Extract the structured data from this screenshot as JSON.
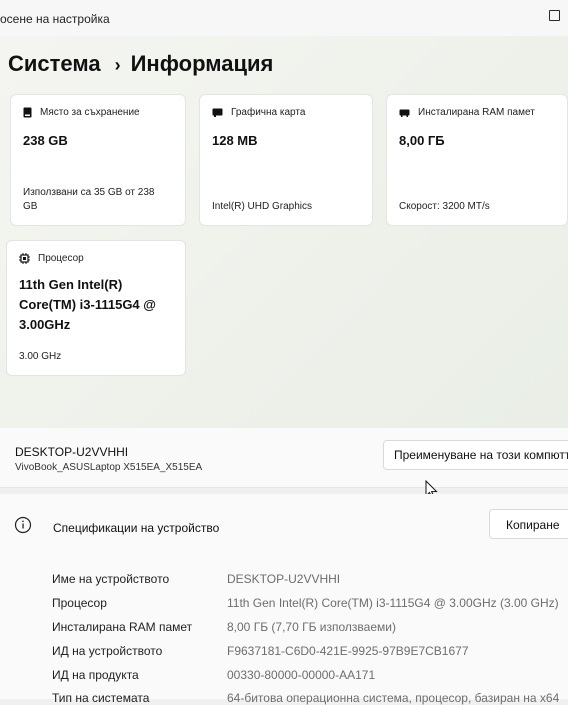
{
  "window": {
    "title": "осене на настройка"
  },
  "breadcrumb": {
    "parent": "Система",
    "separator": "›",
    "current": "Информация"
  },
  "cards": {
    "storage": {
      "label": "Място за съхранение",
      "value": "238 GB",
      "sub_line1": "Използвани са 35 GB от 238",
      "sub_line2": "GB",
      "icon": "storage-icon"
    },
    "graphics": {
      "label": "Графична карта",
      "value": "128 MB",
      "sub": "Intel(R) UHD Graphics",
      "icon": "graphics-card-icon"
    },
    "ram": {
      "label": "Инсталирана RAM памет",
      "value": "8,00 ГБ",
      "sub": "Скорост: 3200 MT/s",
      "icon": "ram-icon"
    },
    "cpu": {
      "label": "Процесор",
      "value_line1": "11th Gen Intel(R)",
      "value_line2": "Core(TM) i3-1115G4 @",
      "value_line3": "3.00GHz",
      "sub": "3.00 GHz",
      "icon": "processor-icon"
    }
  },
  "device": {
    "name": "DESKTOP-U2VVHHI",
    "model": "VivoBook_ASUSLaptop X515EA_X515EA",
    "rename_label": "Преименуване на този компютър"
  },
  "specs": {
    "title": "Спецификации на устройство",
    "copy_label": "Копиране",
    "rows": [
      {
        "key": "Име на устройството",
        "value": "DESKTOP-U2VVHHI"
      },
      {
        "key": "Процесор",
        "value": "11th Gen Intel(R) Core(TM) i3-1115G4 @ 3.00GHz (3.00 GHz)"
      },
      {
        "key": "Инсталирана RAM памет",
        "value": "8,00 ГБ (7,70 ГБ използваеми)"
      },
      {
        "key": "ИД на устройството",
        "value": "F9637181-C6D0-421E-9925-97B9E7CB1677"
      },
      {
        "key": "ИД на продукта",
        "value": "00330-80000-00000-AA171"
      },
      {
        "key": "Тип на системата",
        "value": "64-битова операционна система, процесор, базиран на x64"
      }
    ]
  }
}
